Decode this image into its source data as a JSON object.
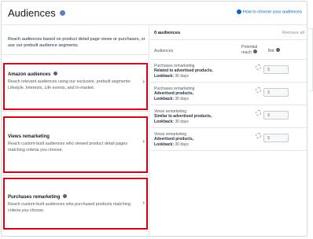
{
  "header": {
    "title": "Audiences",
    "help_link": "How to choose your audiences"
  },
  "left": {
    "intro": "Reach audiences based on product detail page views or purchases, or use our prebuilt audience segments.",
    "categories": [
      {
        "title": "Amazon audiences",
        "description": "Reach relevant audiences using our exclusive, prebuilt segments: Lifestyle, Interests, Life events, and In-market."
      },
      {
        "title": "Views remarketing",
        "description": "Reach custom-built audiences who viewed product detail pages matching criteria you choose."
      },
      {
        "title": "Purchases remarketing",
        "description": "Reach custom-built audiences who purchased products matching criteria you choose."
      }
    ]
  },
  "right": {
    "count_label": "0 audiences",
    "remove_all": "Remove all",
    "columns": {
      "audiences": "Audiences",
      "reach": "Potential reach",
      "bid": "Bid"
    },
    "rows": [
      {
        "line1": "Purchases remarketing",
        "line2": "Related to advertised products,",
        "line3": "Lookback:",
        "line3_value": "30 days",
        "bid": "$"
      },
      {
        "line1": "Purchases remarketing",
        "line2": "Advertised products,",
        "line3": "Lookback:",
        "line3_value": "30 days",
        "bid": "$"
      },
      {
        "line1": "Views remarketing",
        "line2": "Similar to advertised products,",
        "line3": "Lookback:",
        "line3_value": "30 days",
        "bid": "$"
      },
      {
        "line1": "Views remarketing",
        "line2": "Advertised products,",
        "line3": "Lookback:",
        "line3_value": "30 days",
        "bid": "$"
      }
    ]
  },
  "colors": {
    "link": "#0066c0",
    "highlight": "#d0021b",
    "border": "#e3e6e6"
  }
}
